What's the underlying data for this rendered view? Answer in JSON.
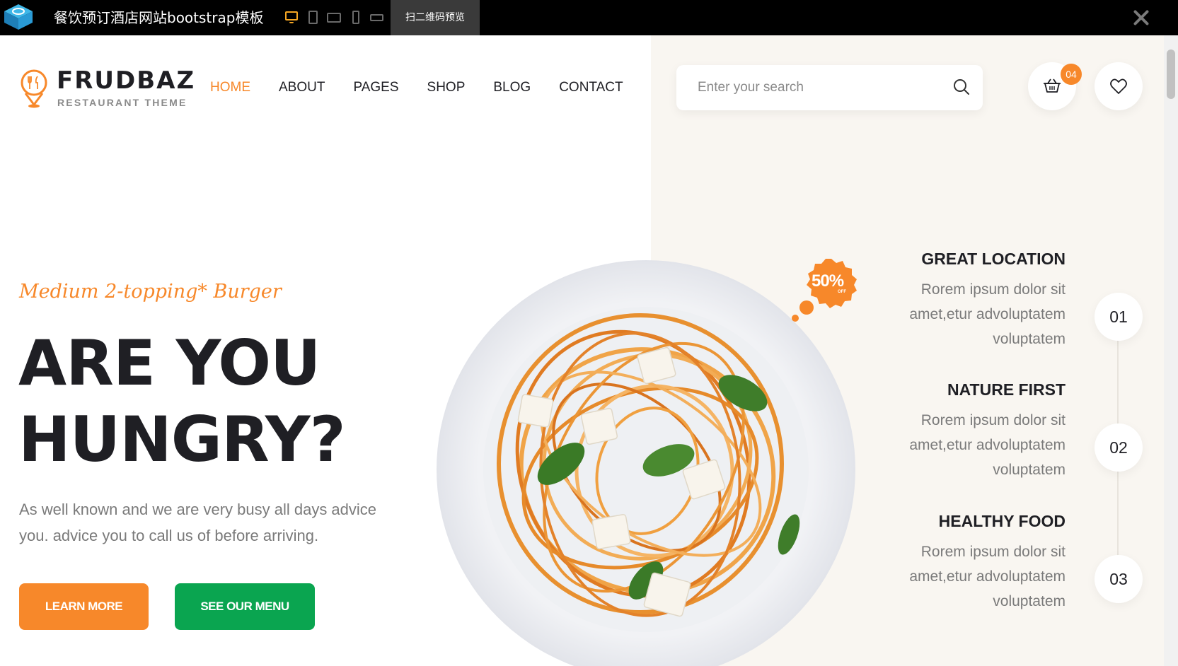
{
  "topbar": {
    "title": "餐饮预订酒店网站bootstrap模板",
    "qr_label": "扫二维码预览",
    "devices": [
      "desktop-icon",
      "tablet-portrait-icon",
      "tablet-landscape-icon",
      "phone-portrait-icon",
      "phone-landscape-icon"
    ],
    "active_device": "desktop-icon"
  },
  "brand": {
    "name": "FRUDBAZ",
    "subtitle": "RESTAURANT THEME"
  },
  "nav": {
    "items": [
      {
        "label": "HOME",
        "active": true
      },
      {
        "label": "ABOUT",
        "active": false
      },
      {
        "label": "PAGES",
        "active": false
      },
      {
        "label": "SHOP",
        "active": false
      },
      {
        "label": "BLOG",
        "active": false
      },
      {
        "label": "CONTACT",
        "active": false
      }
    ]
  },
  "search": {
    "placeholder": "Enter your search",
    "value": ""
  },
  "cart": {
    "count": "04"
  },
  "hero": {
    "script": "Medium 2-topping* Burger",
    "title_line1": "ARE YOU",
    "title_line2": "HUNGRY?",
    "description": "As well known and we are very busy all days advice you. advice you to call us of before arriving.",
    "learn_more": "LEARN MORE",
    "see_menu": "SEE OUR MENU",
    "discount": "50%",
    "discount_off": "OFF"
  },
  "features": [
    {
      "number": "01",
      "title": "GREAT LOCATION",
      "text": "Rorem ipsum dolor sit amet,etur advoluptatem voluptatem"
    },
    {
      "number": "02",
      "title": "NATURE FIRST",
      "text": "Rorem ipsum dolor sit amet,etur advoluptatem voluptatem"
    },
    {
      "number": "03",
      "title": "HEALTHY FOOD",
      "text": "Rorem ipsum dolor sit amet,etur advoluptatem voluptatem"
    }
  ],
  "colors": {
    "accent": "#f7882a",
    "green": "#0aa550",
    "dark": "#1f1f24",
    "cream": "#f9f6f1"
  }
}
